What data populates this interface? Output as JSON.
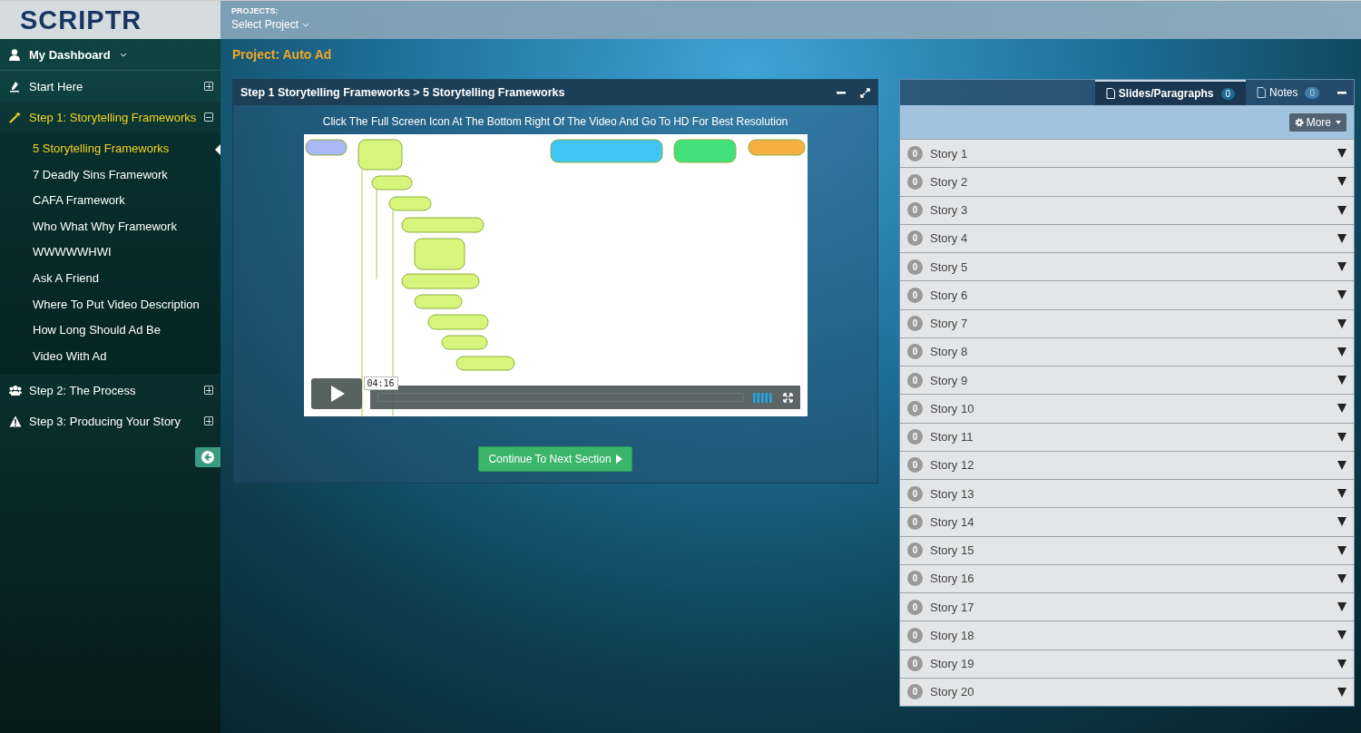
{
  "header": {
    "logo": "SCRIPTR",
    "projects_label": "PROJECTS:",
    "project_select": "Select Project"
  },
  "sidebar": {
    "dashboard": {
      "label": "My Dashboard"
    },
    "items": [
      {
        "label": "Start Here",
        "selected": false,
        "expanded": false
      },
      {
        "label": "Step 1: Storytelling Frameworks",
        "selected": true,
        "expanded": true,
        "children": [
          {
            "label": "5 Storytelling Frameworks",
            "selected": true
          },
          {
            "label": "7 Deadly Sins Framework",
            "selected": false
          },
          {
            "label": "CAFA Framework",
            "selected": false
          },
          {
            "label": "Who What Why Framework",
            "selected": false
          },
          {
            "label": "WWWWWHWI",
            "selected": false
          },
          {
            "label": "Ask A Friend",
            "selected": false
          },
          {
            "label": "Where To Put Video Description",
            "selected": false
          },
          {
            "label": "How Long Should Ad Be",
            "selected": false
          },
          {
            "label": "Video With Ad",
            "selected": false
          }
        ]
      },
      {
        "label": "Step 2: The Process",
        "selected": false,
        "expanded": false
      },
      {
        "label": "Step 3: Producing Your Story",
        "selected": false,
        "expanded": false
      }
    ]
  },
  "project_title": "Project: Auto Ad",
  "lesson_panel": {
    "title": "Step 1 Storytelling Frameworks > 5 Storytelling Frameworks",
    "instruction": "Click The Full Screen Icon At The Bottom Right Of The Video And Go To HD For Best Resolution",
    "video": {
      "kind": "picture",
      "time": "04:16",
      "level": 0
    },
    "continue_button": "Continue To Next Section"
  },
  "stories_panel": {
    "tabs": [
      {
        "label": "Slides/Paragraphs",
        "count": "0",
        "selected": true
      },
      {
        "label": "Notes",
        "count": "0",
        "selected": false
      }
    ],
    "more_button": "More",
    "stories": [
      {
        "count": "0",
        "label": "Story 1"
      },
      {
        "count": "0",
        "label": "Story 2"
      },
      {
        "count": "0",
        "label": "Story 3"
      },
      {
        "count": "0",
        "label": "Story 4"
      },
      {
        "count": "0",
        "label": "Story 5"
      },
      {
        "count": "0",
        "label": "Story 6"
      },
      {
        "count": "0",
        "label": "Story 7"
      },
      {
        "count": "0",
        "label": "Story 8"
      },
      {
        "count": "0",
        "label": "Story 9"
      },
      {
        "count": "0",
        "label": "Story 10"
      },
      {
        "count": "0",
        "label": "Story 11"
      },
      {
        "count": "0",
        "label": "Story 12"
      },
      {
        "count": "0",
        "label": "Story 13"
      },
      {
        "count": "0",
        "label": "Story 14"
      },
      {
        "count": "0",
        "label": "Story 15"
      },
      {
        "count": "0",
        "label": "Story 16"
      },
      {
        "count": "0",
        "label": "Story 17"
      },
      {
        "count": "0",
        "label": "Story 18"
      },
      {
        "count": "0",
        "label": "Story 19"
      },
      {
        "count": "0",
        "label": "Story 20"
      }
    ]
  }
}
